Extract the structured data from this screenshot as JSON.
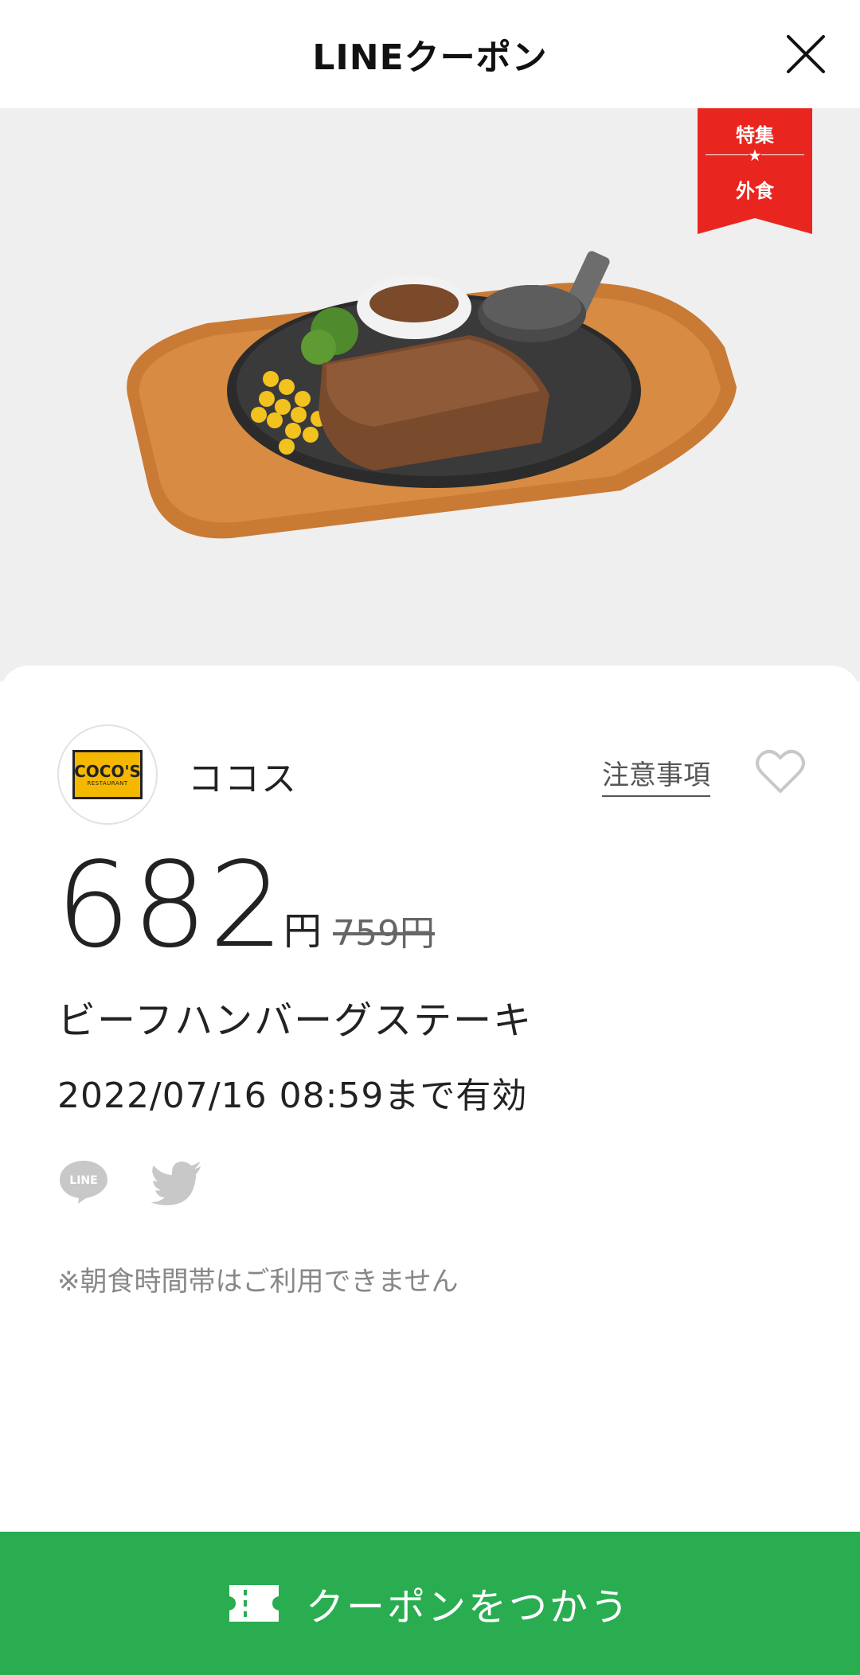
{
  "header": {
    "title": "LINEクーポン"
  },
  "ribbon": {
    "top_text": "特集",
    "star": "★",
    "bottom_text": "外食"
  },
  "shop": {
    "logo_text": "COCO'S",
    "logo_subtext": "RESTAURANT",
    "name": "ココス",
    "notice_label": "注意事項"
  },
  "coupon": {
    "price": "682",
    "currency": "円",
    "original_price": "759円",
    "item_name": "ビーフハンバーグステーキ",
    "expiry": "2022/07/16  08:59まで有効",
    "note": "※朝食時間帯はご利用できません"
  },
  "share": {
    "line_icon_text": "LINE"
  },
  "action": {
    "use_label": "クーポンをつかう"
  },
  "colors": {
    "accent_green": "#2aad51",
    "ribbon_red": "#e8261f",
    "hero_bg": "#efefef"
  },
  "icons": {
    "close": "close-icon",
    "heart": "heart-icon",
    "line": "line-icon",
    "twitter": "twitter-icon",
    "ticket": "ticket-icon"
  }
}
